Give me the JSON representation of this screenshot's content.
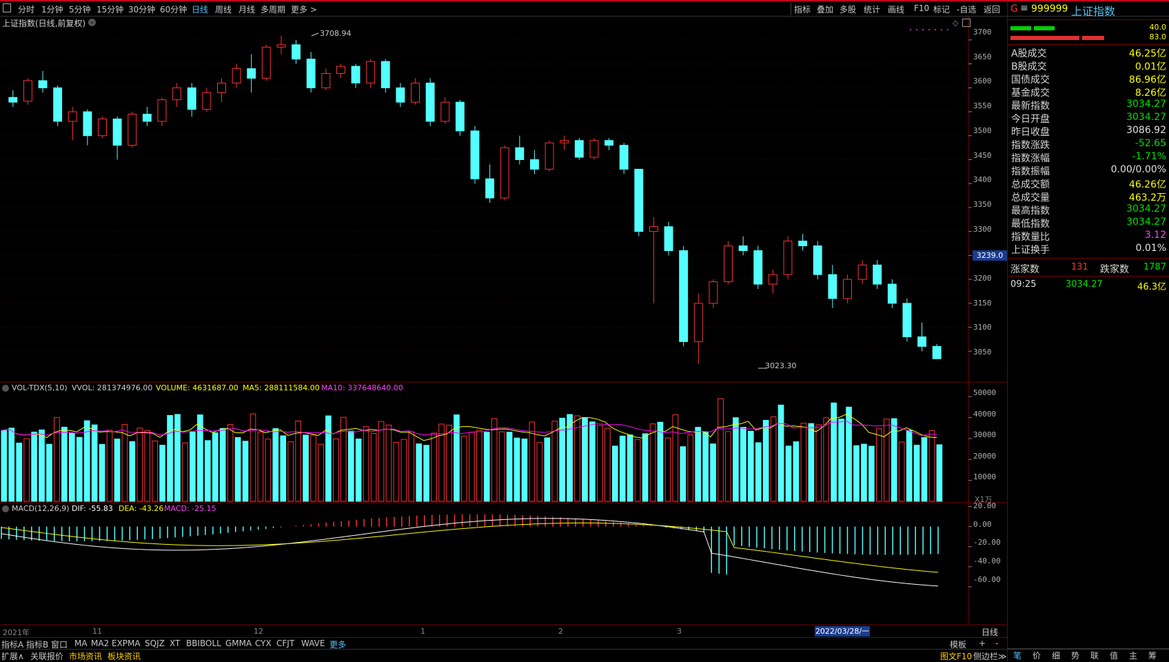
{
  "toolbar": {
    "periods": [
      "分时",
      "1分钟",
      "5分钟",
      "15分钟",
      "30分钟",
      "60分钟",
      "日线",
      "周线",
      "月线",
      "多周期",
      "更多 >"
    ],
    "active_period": "日线",
    "right_items": [
      "指标",
      "叠加",
      "多股",
      "统计",
      "画线",
      "F10",
      "标记",
      "-自选",
      "返回"
    ]
  },
  "chart": {
    "title": "上证指数(日线,前复权)",
    "price_axis": [
      "3700",
      "3650",
      "3600",
      "3550",
      "3500",
      "3450",
      "3400",
      "3350",
      "3300",
      "3250",
      "3200",
      "3150",
      "3100",
      "3050"
    ],
    "price_marker": "3239.0",
    "high_label": "3708.94",
    "low_label": "3023.30",
    "volume_legend": {
      "name": "VOL-TDX(5,10)",
      "vvol": "VVOL: 281374976.00",
      "volume": "VOLUME: 4631687.00",
      "ma5": "MA5: 288111584.00",
      "ma10": "MA10: 337648640.00"
    },
    "volume_axis": [
      "50000",
      "40000",
      "30000",
      "20000",
      "10000"
    ],
    "volume_unit": "X1万",
    "macd_legend": {
      "name": "MACD(12,26,9)",
      "dif": "DIF: -55.83",
      "dea": "DEA: -43.26",
      "macd": "MACD: -25.15"
    },
    "macd_axis": [
      "20.00",
      "0.00",
      "-20.00",
      "-40.00",
      "-60.00"
    ],
    "date_axis": [
      "2021年",
      "11",
      "12",
      "1",
      "2",
      "3"
    ],
    "cursor_date": "2022/03/28/一",
    "period_label": "日线"
  },
  "colors": {
    "up": "#ff3232",
    "down": "#54ffff",
    "ma5": "#ffff00",
    "ma10": "#ff00ff",
    "dif": "#ffffff",
    "dea": "#ffff00",
    "grid": "#7a0000",
    "brand_red": "#c8001e"
  },
  "chart_data": {
    "type": "candlestick",
    "ohlc_sampled": [
      [
        3580,
        3595,
        3560,
        3570
      ],
      [
        3572,
        3620,
        3565,
        3615
      ],
      [
        3615,
        3635,
        3590,
        3600
      ],
      [
        3600,
        3605,
        3520,
        3530
      ],
      [
        3530,
        3560,
        3490,
        3550
      ],
      [
        3550,
        3555,
        3480,
        3500
      ],
      [
        3500,
        3540,
        3495,
        3535
      ],
      [
        3535,
        3540,
        3450,
        3480
      ],
      [
        3480,
        3550,
        3475,
        3545
      ],
      [
        3545,
        3560,
        3520,
        3530
      ],
      [
        3530,
        3580,
        3520,
        3575
      ],
      [
        3575,
        3610,
        3560,
        3600
      ],
      [
        3600,
        3610,
        3540,
        3555
      ],
      [
        3555,
        3600,
        3550,
        3590
      ],
      [
        3590,
        3620,
        3570,
        3610
      ],
      [
        3610,
        3650,
        3600,
        3640
      ],
      [
        3640,
        3670,
        3590,
        3620
      ],
      [
        3620,
        3690,
        3615,
        3685
      ],
      [
        3685,
        3709,
        3670,
        3690
      ],
      [
        3690,
        3700,
        3650,
        3660
      ],
      [
        3660,
        3675,
        3590,
        3600
      ],
      [
        3600,
        3640,
        3595,
        3630
      ],
      [
        3630,
        3650,
        3620,
        3645
      ],
      [
        3645,
        3650,
        3600,
        3610
      ],
      [
        3610,
        3660,
        3600,
        3655
      ],
      [
        3655,
        3660,
        3590,
        3600
      ],
      [
        3600,
        3610,
        3560,
        3570
      ],
      [
        3570,
        3620,
        3565,
        3610
      ],
      [
        3610,
        3620,
        3520,
        3530
      ],
      [
        3530,
        3580,
        3525,
        3570
      ],
      [
        3570,
        3575,
        3500,
        3510
      ],
      [
        3510,
        3520,
        3400,
        3410
      ],
      [
        3410,
        3440,
        3360,
        3370
      ],
      [
        3370,
        3480,
        3365,
        3475
      ],
      [
        3475,
        3500,
        3440,
        3450
      ],
      [
        3450,
        3470,
        3420,
        3430
      ],
      [
        3430,
        3490,
        3425,
        3485
      ],
      [
        3485,
        3500,
        3470,
        3490
      ],
      [
        3490,
        3495,
        3450,
        3455
      ],
      [
        3455,
        3495,
        3450,
        3490
      ],
      [
        3490,
        3495,
        3470,
        3480
      ],
      [
        3480,
        3485,
        3420,
        3430
      ],
      [
        3430,
        3380,
        3290,
        3300
      ],
      [
        3300,
        3330,
        3150,
        3310
      ],
      [
        3310,
        3320,
        3250,
        3260
      ],
      [
        3260,
        3270,
        3060,
        3070
      ],
      [
        3070,
        3170,
        3023.3,
        3150
      ],
      [
        3150,
        3200,
        3140,
        3195
      ],
      [
        3195,
        3280,
        3190,
        3270
      ],
      [
        3270,
        3290,
        3250,
        3260
      ],
      [
        3260,
        3270,
        3180,
        3190
      ],
      [
        3190,
        3220,
        3170,
        3210
      ],
      [
        3210,
        3290,
        3200,
        3280
      ],
      [
        3280,
        3295,
        3260,
        3270
      ],
      [
        3270,
        3280,
        3200,
        3210
      ],
      [
        3210,
        3230,
        3140,
        3160
      ],
      [
        3160,
        3210,
        3150,
        3200
      ],
      [
        3200,
        3240,
        3190,
        3230
      ],
      [
        3230,
        3240,
        3180,
        3190
      ],
      [
        3190,
        3200,
        3140,
        3150
      ],
      [
        3150,
        3160,
        3070,
        3080
      ],
      [
        3080,
        3110,
        3050,
        3060
      ],
      [
        3060,
        3065,
        3034,
        3034.27
      ]
    ],
    "ylim": [
      3000,
      3720
    ],
    "volume_ylim": [
      0,
      55000
    ],
    "macd_ylim": [
      -80,
      30
    ]
  },
  "right_panel": {
    "code_prefix": "G",
    "code": "999999",
    "name": "上证指数",
    "bar_values": [
      "40.0",
      "83.0"
    ],
    "rows": [
      {
        "label": "A股成交",
        "value": "46.25亿",
        "color": "#ffff00"
      },
      {
        "label": "B股成交",
        "value": "0.01亿",
        "color": "#ffff00"
      },
      {
        "label": "国债成交",
        "value": "86.96亿",
        "color": "#ffff00"
      },
      {
        "label": "基金成交",
        "value": "8.26亿",
        "color": "#ffff00"
      },
      {
        "label": "最新指数",
        "value": "3034.27",
        "color": "#00e000"
      },
      {
        "label": "今日开盘",
        "value": "3034.27",
        "color": "#00e000"
      },
      {
        "label": "昨日收盘",
        "value": "3086.92",
        "color": "#e0e0e0"
      },
      {
        "label": "指数涨跌",
        "value": "-52.65",
        "color": "#00e000"
      },
      {
        "label": "指数涨幅",
        "value": "-1.71%",
        "color": "#00e000"
      },
      {
        "label": "指数振幅",
        "value": "0.00/0.00%",
        "color": "#e0e0e0"
      },
      {
        "label": "总成交额",
        "value": "46.26亿",
        "color": "#ffff00"
      },
      {
        "label": "总成交量",
        "value": "463.2万",
        "color": "#ffff00"
      },
      {
        "label": "最高指数",
        "value": "3034.27",
        "color": "#00e000"
      },
      {
        "label": "最低指数",
        "value": "3034.27",
        "color": "#00e000"
      },
      {
        "label": "指数量比",
        "value": "3.12",
        "color": "#ff40ff"
      },
      {
        "label": "上证换手",
        "value": "0.01%",
        "color": "#e0e0e0"
      }
    ],
    "up_label": "涨家数",
    "up_count": "131",
    "down_label": "跌家数",
    "down_count": "1787",
    "tick_time": "09:25",
    "tick_price": "3034.27",
    "tick_amount": "46.3亿",
    "bottom_tabs": [
      "笔",
      "价",
      "细",
      "势",
      "联",
      "值",
      "主",
      "筹"
    ]
  },
  "bottom_bar": {
    "indicators": [
      "指标A",
      "指标B",
      "窗口",
      "MA",
      "MA2",
      "EXPMA",
      "SQJZ",
      "XT",
      "BBIBOLL",
      "GMMA",
      "CYX",
      "CFJT",
      "WAVE",
      "更多"
    ],
    "right_items": [
      "模板",
      "+",
      "-"
    ],
    "tabs": [
      "扩展∧",
      "关联报价",
      "市场资讯",
      "板块资讯"
    ],
    "right_tabs": [
      "图文F10",
      "侧边栏≫"
    ]
  }
}
